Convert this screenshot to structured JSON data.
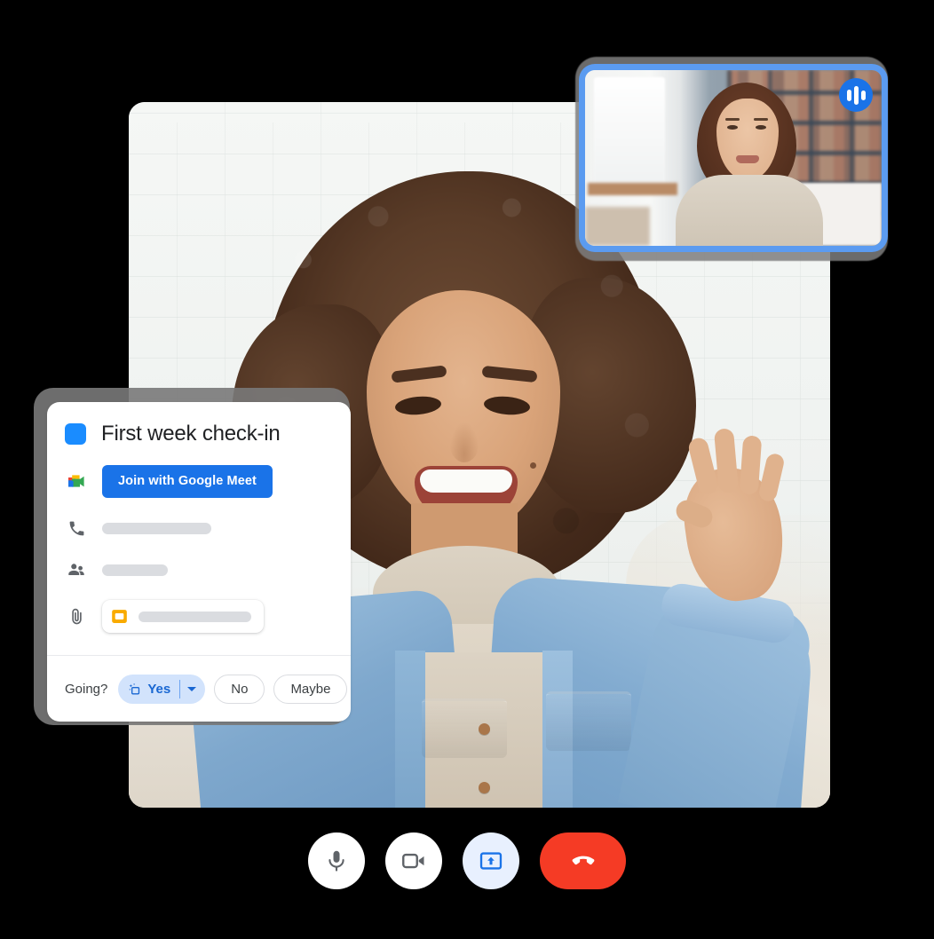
{
  "app": {
    "name": "Google Meet",
    "scene": "video-call-with-calendar-invite"
  },
  "main_video": {
    "participant_label": "",
    "description": "Smiling woman with curly hair waving, wearing denim jacket over beige turtleneck, white brick wall background"
  },
  "pip_video": {
    "participant_label": "",
    "description": "Woman in beige top in front of bookshelves, window to the left",
    "speaking_indicator": "audio-wave-icon",
    "border_color": "#5b9bf0",
    "badge_color": "#1a73e8"
  },
  "calendar_card": {
    "title": "First week check-in",
    "color_swatch": "#1a8cff",
    "meet_logo_icon": "google-meet-icon",
    "join_button": {
      "label": "Join with Google Meet",
      "color": "#1a73e8",
      "text_color": "#ffffff"
    },
    "rows": [
      {
        "icon": "phone-icon",
        "value": ""
      },
      {
        "icon": "people-icon",
        "value": ""
      }
    ],
    "attachment": {
      "icon": "paperclip-icon",
      "file_icon": "google-slides-icon",
      "file_name": ""
    },
    "rsvp": {
      "prompt": "Going?",
      "selected": "Yes",
      "yes_label": "Yes",
      "yes_icon": "add-room-sparkle-icon",
      "yes_bg": "#d2e3fc",
      "yes_text_color": "#1967d2",
      "dropdown_icon": "chevron-down-icon",
      "no_label": "No",
      "maybe_label": "Maybe"
    }
  },
  "controls": [
    {
      "name": "microphone",
      "icon": "microphone-icon",
      "state": "on",
      "bg": "#ffffff",
      "fg": "#5f6368"
    },
    {
      "name": "camera",
      "icon": "video-camera-icon",
      "state": "on",
      "bg": "#ffffff",
      "fg": "#5f6368"
    },
    {
      "name": "present",
      "icon": "present-screen-icon",
      "state": "active",
      "bg": "#e8f0fe",
      "fg": "#1a73e8"
    },
    {
      "name": "end-call",
      "icon": "end-call-icon",
      "state": "default",
      "bg": "#f53b25",
      "fg": "#ffffff"
    }
  ]
}
